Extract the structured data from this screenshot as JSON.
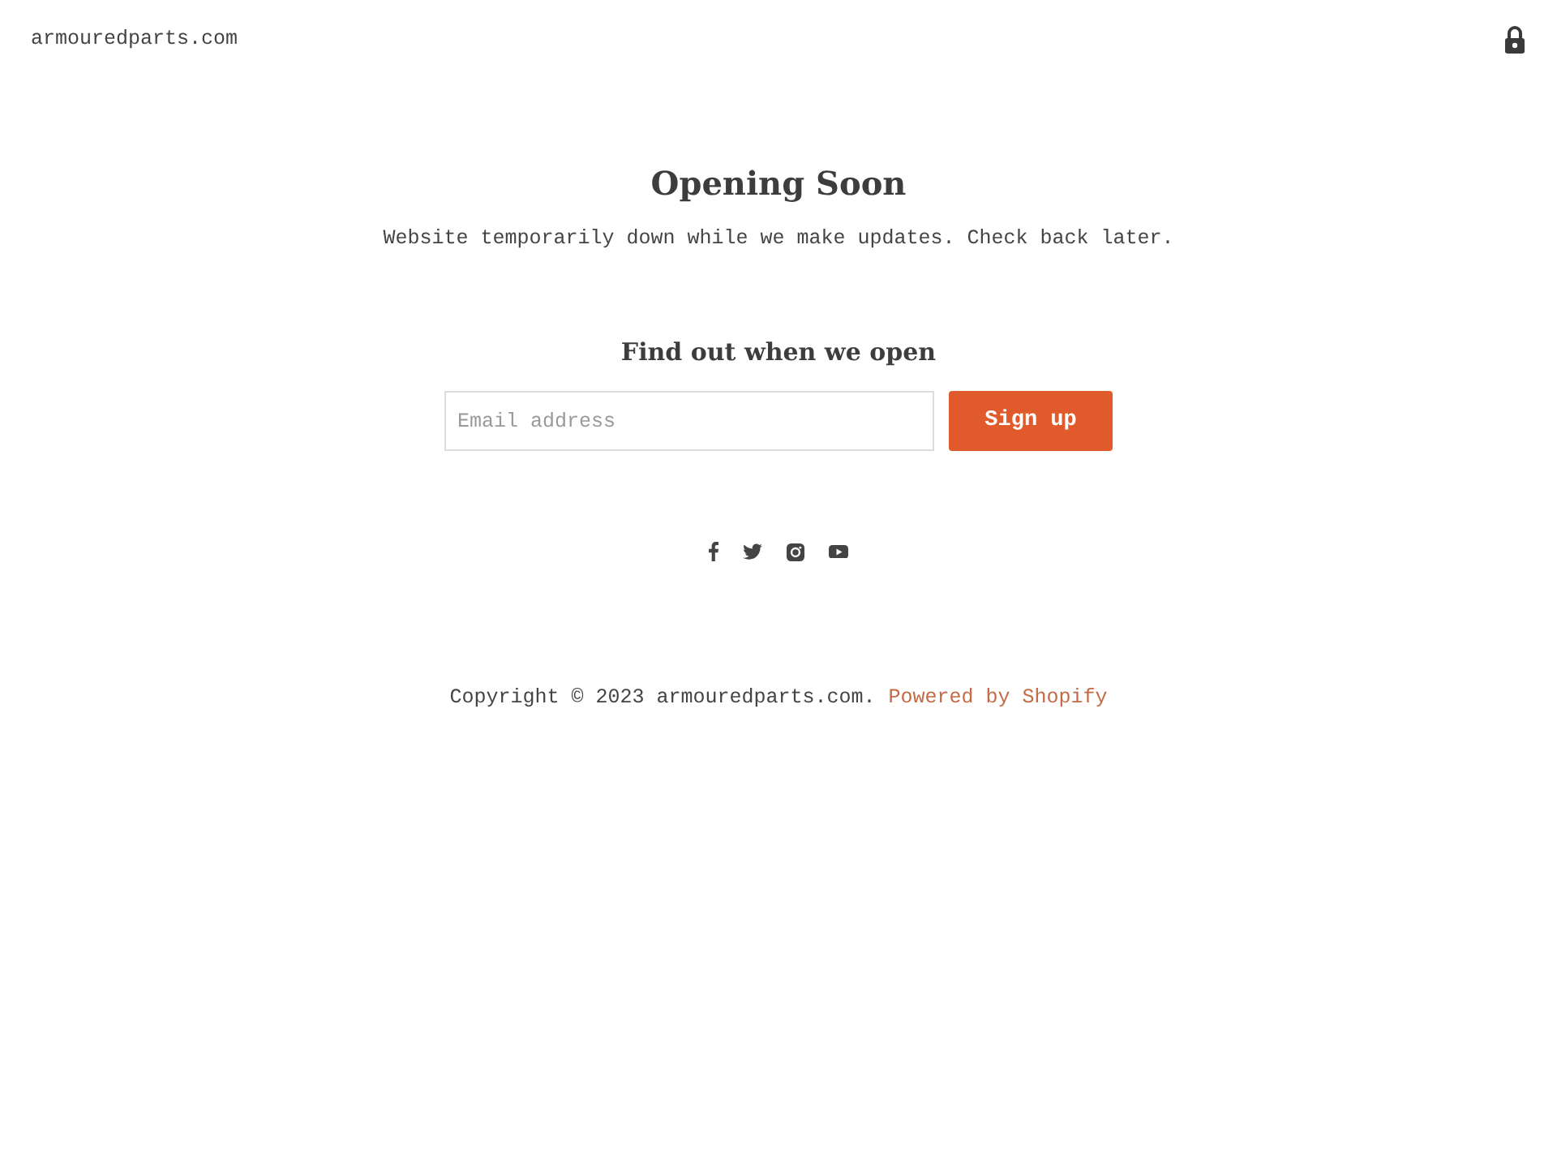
{
  "header": {
    "site_name": "armouredparts.com"
  },
  "main": {
    "title": "Opening Soon",
    "message": "Website temporarily down while we make updates. Check back later."
  },
  "signup": {
    "heading": "Find out when we open",
    "email_field": {
      "placeholder": "Email address"
    },
    "button": "Sign up"
  },
  "social_links": [
    {
      "kind": "facebook"
    },
    {
      "kind": "twitter"
    },
    {
      "kind": "instagram"
    },
    {
      "kind": "youtube"
    }
  ],
  "footer": {
    "copyright": "Copyright © 2023 armouredparts.com.",
    "powered_by": "Powered by Shopify"
  }
}
